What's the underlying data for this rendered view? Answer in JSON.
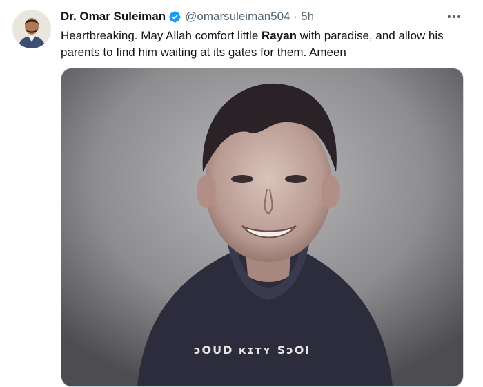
{
  "tweet": {
    "author": {
      "name": "Dr. Omar Suleiman",
      "handle": "@omarsuleiman504",
      "verified": true,
      "avatar_icon": "profile-photo"
    },
    "separator": "·",
    "time": "5h",
    "more_icon": "ellipsis-icon",
    "text": {
      "part1": "Heartbreaking. May Allah comfort little ",
      "bold": "Rayan",
      "part2": " with paradise, and allow his parents to find him waiting at its gates for them. Ameen"
    },
    "media": {
      "description_icon": "photo",
      "shirt_print": "ɔOUD  ᴋɪᴛʏ  SɔOI"
    }
  },
  "colors": {
    "text": "#0f1419",
    "secondary": "#536471",
    "verified": "#1d9bf0",
    "border": "#cfd9de"
  }
}
